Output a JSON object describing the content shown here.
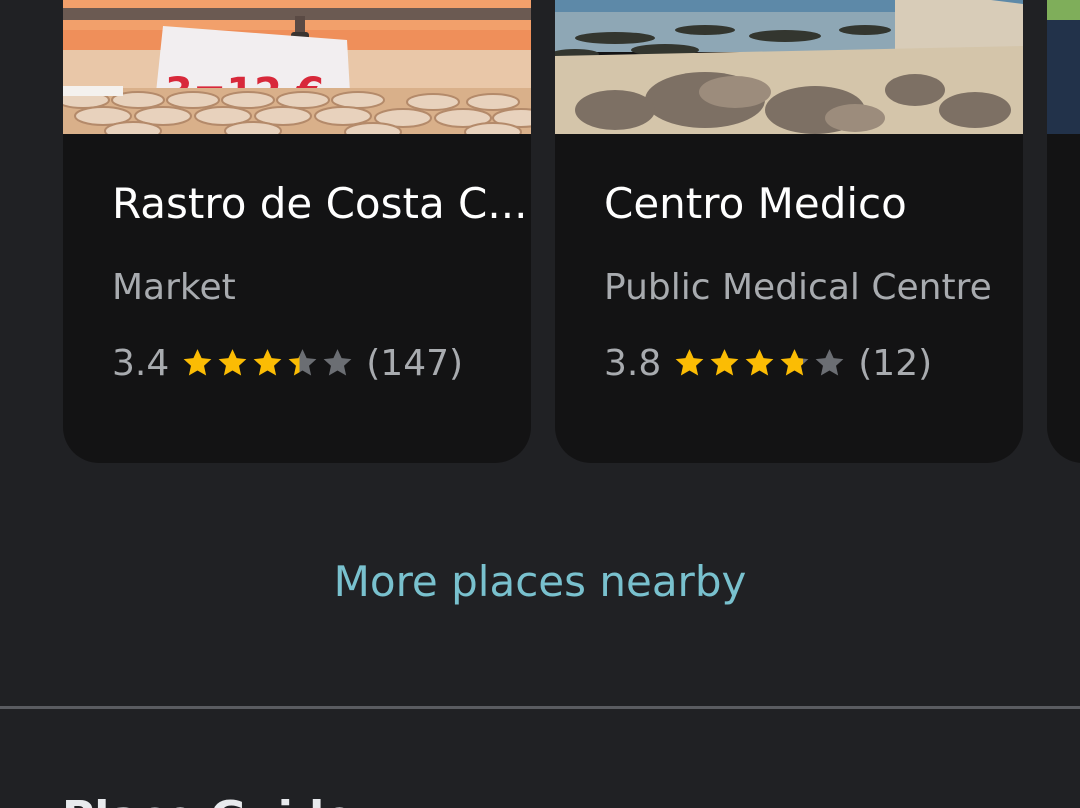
{
  "places": [
    {
      "name": "Rastro de Costa C...",
      "category": "Market",
      "rating": "3.4",
      "rating_value": 3.4,
      "review_count": "(147)",
      "photo_sign_text": "3=12 €"
    },
    {
      "name": "Centro Medico",
      "category": "Public Medical Centre",
      "rating": "3.8",
      "rating_value": 3.8,
      "review_count": "(12)"
    }
  ],
  "more_link": "More places nearby",
  "next_section": {
    "title": "Place Guide"
  },
  "colors": {
    "background": "#202124",
    "card": "#131314",
    "star": "#fbbc04",
    "star_empty": "#6b6e73",
    "link": "#79c1ce"
  }
}
